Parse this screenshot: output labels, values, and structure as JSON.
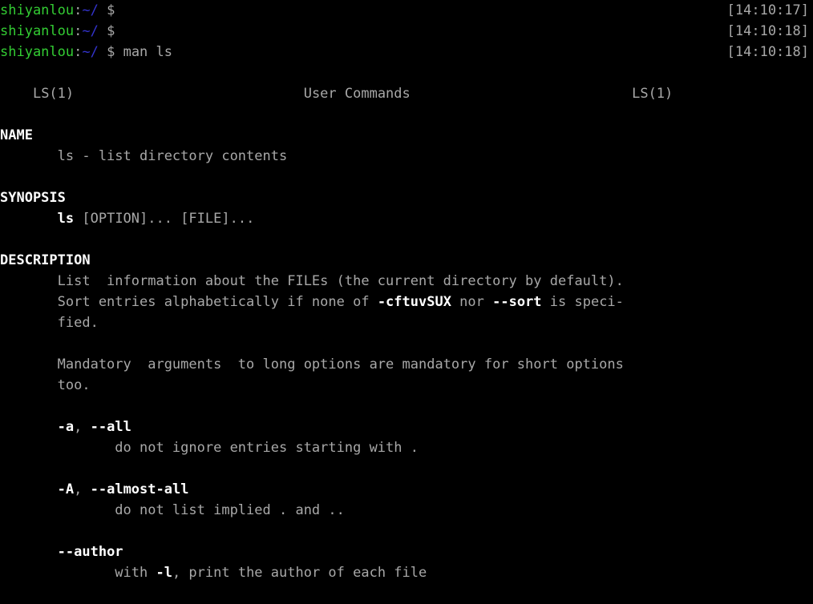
{
  "terminal": {
    "background_color": "#000000",
    "foreground_color": "#a8a8a8",
    "prompt_host_color": "#33cc33",
    "prompt_path_color": "#3333cc",
    "bold_color": "#ffffff",
    "columns": 78,
    "rows": 29
  },
  "prompt": {
    "host": "shiyanlou",
    "separator": ":",
    "path": "~/",
    "symbol": "$"
  },
  "shell_lines": [
    {
      "command": "",
      "timestamp": "[14:10:17]"
    },
    {
      "command": "",
      "timestamp": "[14:10:18]"
    },
    {
      "command": " man ls",
      "timestamp": "[14:10:18]"
    }
  ],
  "man_page": {
    "header": {
      "left": "LS(1)",
      "center": "User Commands",
      "right": "LS(1)"
    },
    "sections": [
      {
        "heading": "NAME",
        "body": [
          [
            {
              "text": "       ls - list directory contents",
              "bold": false
            }
          ]
        ]
      },
      {
        "heading": "SYNOPSIS",
        "body": [
          [
            {
              "text": "       ",
              "bold": false
            },
            {
              "text": "ls",
              "bold": true
            },
            {
              "text": " [OPTION]... [FILE]...",
              "bold": false
            }
          ]
        ]
      },
      {
        "heading": "DESCRIPTION",
        "body": [
          [
            {
              "text": "       List  information about the FILEs (the current directory by default).",
              "bold": false
            }
          ],
          [
            {
              "text": "       Sort entries alphabetically if none of ",
              "bold": false
            },
            {
              "text": "-cftuvSUX",
              "bold": true
            },
            {
              "text": " nor ",
              "bold": false
            },
            {
              "text": "--sort",
              "bold": true
            },
            {
              "text": " is speci-",
              "bold": false
            }
          ],
          [
            {
              "text": "       fied.",
              "bold": false
            }
          ],
          [
            {
              "text": "",
              "bold": false
            }
          ],
          [
            {
              "text": "       Mandatory  arguments  to long options are mandatory for short options",
              "bold": false
            }
          ],
          [
            {
              "text": "       too.",
              "bold": false
            }
          ],
          [
            {
              "text": "",
              "bold": false
            }
          ],
          [
            {
              "text": "       ",
              "bold": false
            },
            {
              "text": "-a",
              "bold": true
            },
            {
              "text": ", ",
              "bold": false
            },
            {
              "text": "--all",
              "bold": true
            }
          ],
          [
            {
              "text": "              do not ignore entries starting with .",
              "bold": false
            }
          ],
          [
            {
              "text": "",
              "bold": false
            }
          ],
          [
            {
              "text": "       ",
              "bold": false
            },
            {
              "text": "-A",
              "bold": true
            },
            {
              "text": ", ",
              "bold": false
            },
            {
              "text": "--almost-all",
              "bold": true
            }
          ],
          [
            {
              "text": "              do not list implied . and ..",
              "bold": false
            }
          ],
          [
            {
              "text": "",
              "bold": false
            }
          ],
          [
            {
              "text": "       ",
              "bold": false
            },
            {
              "text": "--author",
              "bold": true
            }
          ],
          [
            {
              "text": "              with ",
              "bold": false
            },
            {
              "text": "-l",
              "bold": true
            },
            {
              "text": ", print the author of each file",
              "bold": false
            }
          ]
        ]
      }
    ]
  }
}
